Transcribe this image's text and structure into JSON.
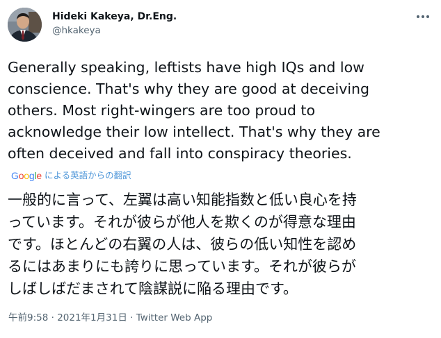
{
  "author": {
    "display_name": "Hideki Kakeya, Dr.Eng.",
    "handle": "@hkakeya"
  },
  "tweet": {
    "text_lines": [
      "Generally speaking, leftists have high IQs and low",
      "conscience. That's why they are good at deceiving",
      "others. Most right-wingers are too proud to",
      "acknowledge their low intellect. That's why they are",
      "often deceived and fall into conspiracy theories."
    ]
  },
  "translation": {
    "logo_text": "Google",
    "label": "による英語からの翻訳",
    "text_lines": [
      "一般的に言って、左翼は高い知能指数と低い良心を持",
      "っています。それが彼らが他人を欺くのが得意な理由",
      "です。ほとんどの右翼の人は、彼らの低い知性を認め",
      "るにはあまりにも誇りに思っています。それが彼らが",
      "しばしばだまされて陰謀説に陥る理由です。"
    ]
  },
  "meta": {
    "time": "午前9:58",
    "separator": " · ",
    "date": "2021年1月31日",
    "source": "Twitter Web App"
  },
  "icons": {
    "more": "more-horizontal-icon",
    "avatar": "avatar-photo"
  },
  "colors": {
    "text": "#0f1419",
    "secondary": "#536471",
    "translate_link": "#4d96d9",
    "google_blue": "#4285f4",
    "google_red": "#ea4335",
    "google_yellow": "#fbbc05",
    "google_green": "#34a853"
  }
}
